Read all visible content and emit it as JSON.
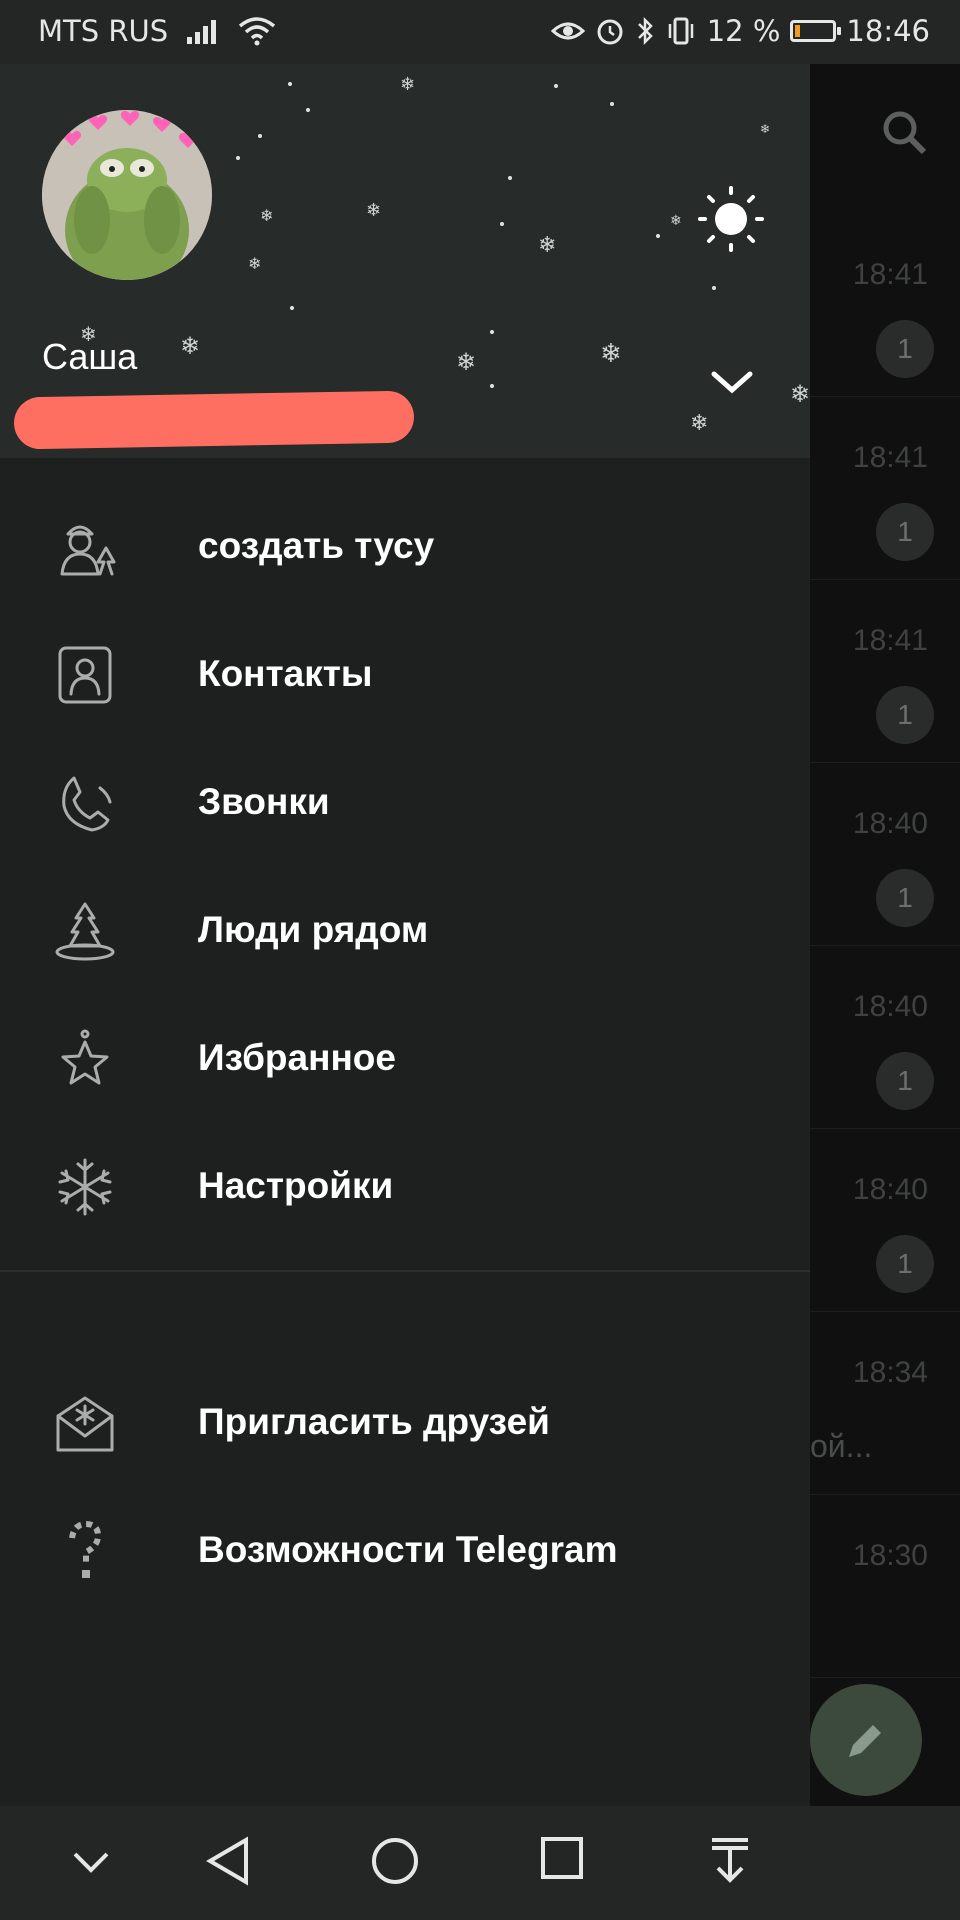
{
  "status_bar": {
    "carrier": "MTS RUS",
    "battery_percent": "12 %",
    "battery_level": 0.12,
    "time": "18:46"
  },
  "drawer": {
    "user": {
      "name": "Саша"
    },
    "menu": [
      {
        "label": "создать тусу",
        "icon": "snowman-icon"
      },
      {
        "label": "Контакты",
        "icon": "contact-card-icon"
      },
      {
        "label": "Звонки",
        "icon": "phone-icon"
      },
      {
        "label": "Люди рядом",
        "icon": "tree-icon"
      },
      {
        "label": "Избранное",
        "icon": "star-ornament-icon"
      },
      {
        "label": "Настройки",
        "icon": "snowflake-icon"
      }
    ],
    "menu_secondary": [
      {
        "label": "Пригласить друзей",
        "icon": "envelope-icon"
      },
      {
        "label": "Возможности Telegram",
        "icon": "candy-cane-question-icon"
      }
    ]
  },
  "background_chats": [
    {
      "time": "18:41",
      "unread": "1"
    },
    {
      "time": "18:41",
      "unread": "1"
    },
    {
      "time": "18:41",
      "unread": "1"
    },
    {
      "time": "18:40",
      "unread": "1"
    },
    {
      "time": "18:40",
      "unread": "1"
    },
    {
      "time": "18:40",
      "unread": "1"
    },
    {
      "time": "18:34",
      "snippet": "ой..."
    },
    {
      "time": "18:30"
    }
  ],
  "colors": {
    "drawer_bg": "#1e201f",
    "header_bg": "#272b29",
    "redaction": "#ff6f61",
    "battery_fill": "#f39b1f"
  }
}
